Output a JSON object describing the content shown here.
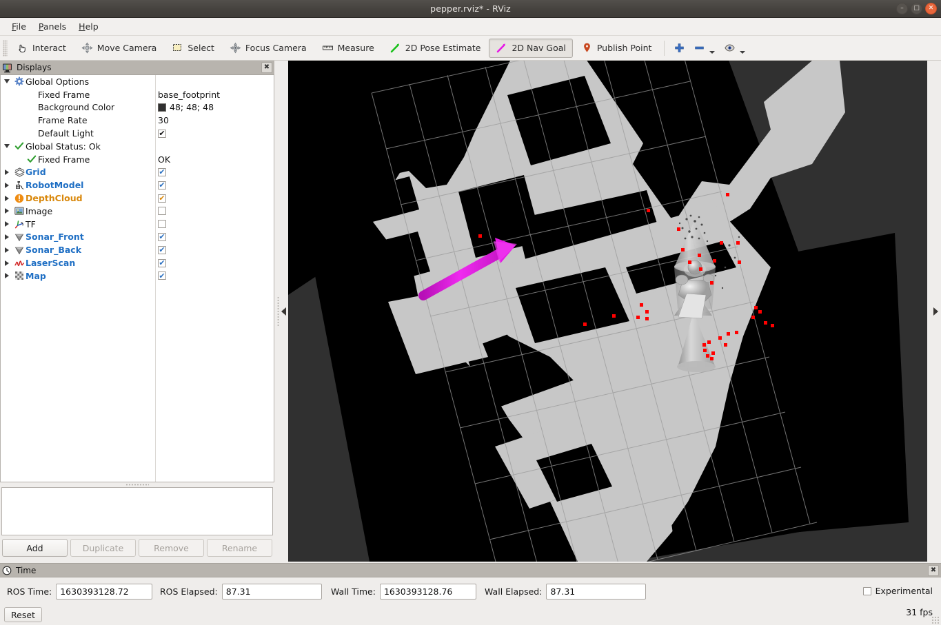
{
  "window": {
    "title": "pepper.rviz* - RViz",
    "buttons": {
      "minimize": "–",
      "maximize": "□",
      "close": "✕"
    }
  },
  "menubar": {
    "items": [
      {
        "label": "File",
        "mnemonic": "F"
      },
      {
        "label": "Panels",
        "mnemonic": "P"
      },
      {
        "label": "Help",
        "mnemonic": "H"
      }
    ]
  },
  "toolbar": {
    "tools": [
      {
        "label": "Interact",
        "icon": "hand-cursor-icon",
        "checked": false
      },
      {
        "label": "Move Camera",
        "icon": "move-camera-icon",
        "checked": false
      },
      {
        "label": "Select",
        "icon": "select-rectangle-icon",
        "checked": false
      },
      {
        "label": "Focus Camera",
        "icon": "focus-camera-icon",
        "checked": false
      },
      {
        "label": "Measure",
        "icon": "ruler-icon",
        "checked": false
      },
      {
        "label": "2D Pose Estimate",
        "icon": "pose-arrow-green-icon",
        "checked": false
      },
      {
        "label": "2D Nav Goal",
        "icon": "nav-goal-arrow-magenta-icon",
        "checked": true
      },
      {
        "label": "Publish Point",
        "icon": "map-pin-icon",
        "checked": false
      }
    ],
    "extra": [
      {
        "icon": "plus-icon",
        "label": ""
      },
      {
        "icon": "minus-icon",
        "label": ""
      },
      {
        "icon": "eye-icon",
        "label": ""
      }
    ]
  },
  "displays_panel": {
    "title": "Displays",
    "icon": "displays-monitor-icon",
    "close_label": "✖",
    "tree": [
      {
        "indent": 0,
        "arrow": "down",
        "icon": "gear-icon",
        "label": "Global Options",
        "style": "plain",
        "value_type": "none"
      },
      {
        "indent": 1,
        "arrow": "none",
        "icon": "none",
        "label": "Fixed Frame",
        "style": "plain",
        "value_type": "text",
        "value": "base_footprint"
      },
      {
        "indent": 1,
        "arrow": "none",
        "icon": "none",
        "label": "Background Color",
        "style": "plain",
        "value_type": "color",
        "value": "48; 48; 48",
        "color": "#303030"
      },
      {
        "indent": 1,
        "arrow": "none",
        "icon": "none",
        "label": "Frame Rate",
        "style": "plain",
        "value_type": "text",
        "value": "30"
      },
      {
        "indent": 1,
        "arrow": "none",
        "icon": "none",
        "label": "Default Light",
        "style": "plain",
        "value_type": "checkbox",
        "checked": true,
        "check_color": "#111111"
      },
      {
        "indent": 0,
        "arrow": "down",
        "icon": "check-green-icon",
        "label": "Global Status: Ok",
        "style": "plain",
        "value_type": "none"
      },
      {
        "indent": 1,
        "arrow": "none",
        "icon": "check-green-icon",
        "label": "Fixed Frame",
        "style": "plain",
        "value_type": "text",
        "value": "OK"
      },
      {
        "indent": 0,
        "arrow": "right",
        "icon": "grid-icon",
        "label": "Grid",
        "style": "blue",
        "value_type": "checkbox",
        "checked": true,
        "check_color": "#2a6fc0"
      },
      {
        "indent": 0,
        "arrow": "right",
        "icon": "robot-model-icon",
        "label": "RobotModel",
        "style": "blue",
        "value_type": "checkbox",
        "checked": true,
        "check_color": "#2a6fc0"
      },
      {
        "indent": 0,
        "arrow": "right",
        "icon": "warning-circle-icon",
        "label": "DepthCloud",
        "style": "orange",
        "value_type": "checkbox",
        "checked": true,
        "check_color": "#d9880c"
      },
      {
        "indent": 0,
        "arrow": "right",
        "icon": "image-icon",
        "label": "Image",
        "style": "plain",
        "value_type": "checkbox",
        "checked": false,
        "check_color": "#2a6fc0"
      },
      {
        "indent": 0,
        "arrow": "right",
        "icon": "tf-axes-icon",
        "label": "TF",
        "style": "plain",
        "value_type": "checkbox",
        "checked": false,
        "check_color": "#2a6fc0"
      },
      {
        "indent": 0,
        "arrow": "right",
        "icon": "sonar-cone-icon",
        "label": "Sonar_Front",
        "style": "blue",
        "value_type": "checkbox",
        "checked": true,
        "check_color": "#2a6fc0"
      },
      {
        "indent": 0,
        "arrow": "right",
        "icon": "sonar-cone-icon",
        "label": "Sonar_Back",
        "style": "blue",
        "value_type": "checkbox",
        "checked": true,
        "check_color": "#2a6fc0"
      },
      {
        "indent": 0,
        "arrow": "right",
        "icon": "laserscan-icon",
        "label": "LaserScan",
        "style": "blue",
        "value_type": "checkbox",
        "checked": true,
        "check_color": "#2a6fc0"
      },
      {
        "indent": 0,
        "arrow": "right",
        "icon": "map-grid-icon",
        "label": "Map",
        "style": "blue",
        "value_type": "checkbox",
        "checked": true,
        "check_color": "#2a6fc0"
      }
    ],
    "description_text": "",
    "buttons": [
      {
        "label": "Add",
        "enabled": true
      },
      {
        "label": "Duplicate",
        "enabled": false
      },
      {
        "label": "Remove",
        "enabled": false
      },
      {
        "label": "Rename",
        "enabled": false
      }
    ]
  },
  "viewport": {
    "background_color": "#303030",
    "map_free_color": "#c8c8c8",
    "map_occupied_color": "#000000",
    "grid_color": "#9a9a9a",
    "laser_point_color": "#ff0000",
    "nav_goal_arrow_color": "#e619e6",
    "robot_color": "#d8d8d8"
  },
  "time_panel": {
    "title": "Time",
    "icon": "clock-icon",
    "close_label": "✖",
    "fields": [
      {
        "label": "ROS Time:",
        "value": "1630393128.72"
      },
      {
        "label": "ROS Elapsed:",
        "value": "87.31"
      },
      {
        "label": "Wall Time:",
        "value": "1630393128.76"
      },
      {
        "label": "Wall Elapsed:",
        "value": "87.31"
      }
    ],
    "reset_label": "Reset",
    "experimental_label": "Experimental",
    "experimental_checked": false,
    "fps": "31 fps"
  }
}
